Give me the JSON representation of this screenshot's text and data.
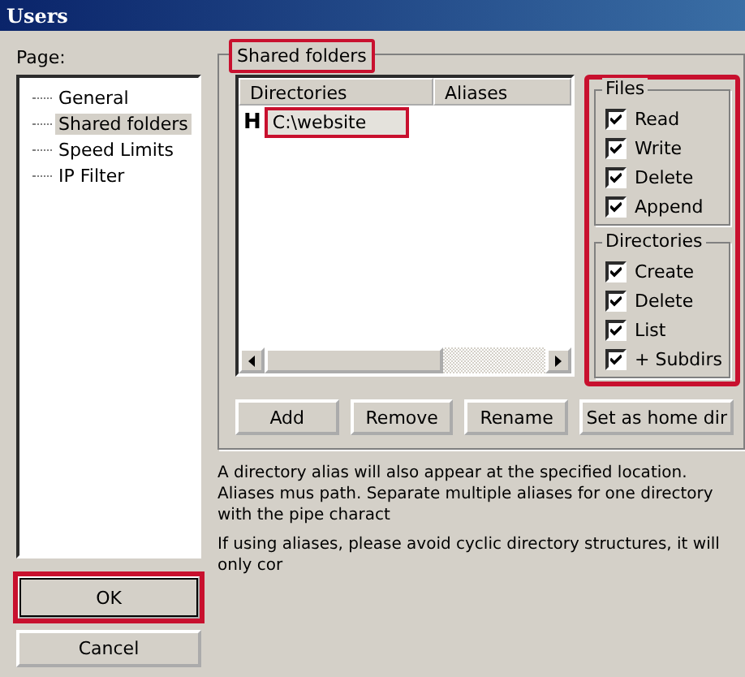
{
  "window": {
    "title": "Users"
  },
  "page_label": "Page:",
  "pages": [
    {
      "label": "General",
      "selected": false
    },
    {
      "label": "Shared folders",
      "selected": true
    },
    {
      "label": "Speed Limits",
      "selected": false
    },
    {
      "label": "IP Filter",
      "selected": false
    }
  ],
  "shared_folders": {
    "title": "Shared folders",
    "highlighted": true,
    "columns": [
      "Directories",
      "Aliases"
    ],
    "rows": [
      {
        "marker": "H",
        "directory": "C:\\website",
        "selected": true,
        "highlighted": true
      }
    ],
    "permissions_highlighted": true,
    "permission_groups": [
      {
        "title": "Files",
        "items": [
          {
            "label": "Read",
            "checked": true
          },
          {
            "label": "Write",
            "checked": true
          },
          {
            "label": "Delete",
            "checked": true
          },
          {
            "label": "Append",
            "checked": true
          }
        ]
      },
      {
        "title": "Directories",
        "items": [
          {
            "label": "Create",
            "checked": true
          },
          {
            "label": "Delete",
            "checked": true
          },
          {
            "label": "List",
            "checked": true
          },
          {
            "label": "+ Subdirs",
            "checked": true
          }
        ]
      }
    ],
    "buttons": [
      "Add",
      "Remove",
      "Rename",
      "Set as home dir"
    ]
  },
  "notes": [
    "A directory alias will also appear at the specified location. Aliases mus path. Separate multiple aliases for one directory with the pipe charact",
    "If using aliases, please avoid cyclic directory structures, it will only cor"
  ],
  "dialog_buttons": [
    {
      "label": "OK",
      "highlighted": true
    },
    {
      "label": "Cancel",
      "highlighted": false
    }
  ]
}
